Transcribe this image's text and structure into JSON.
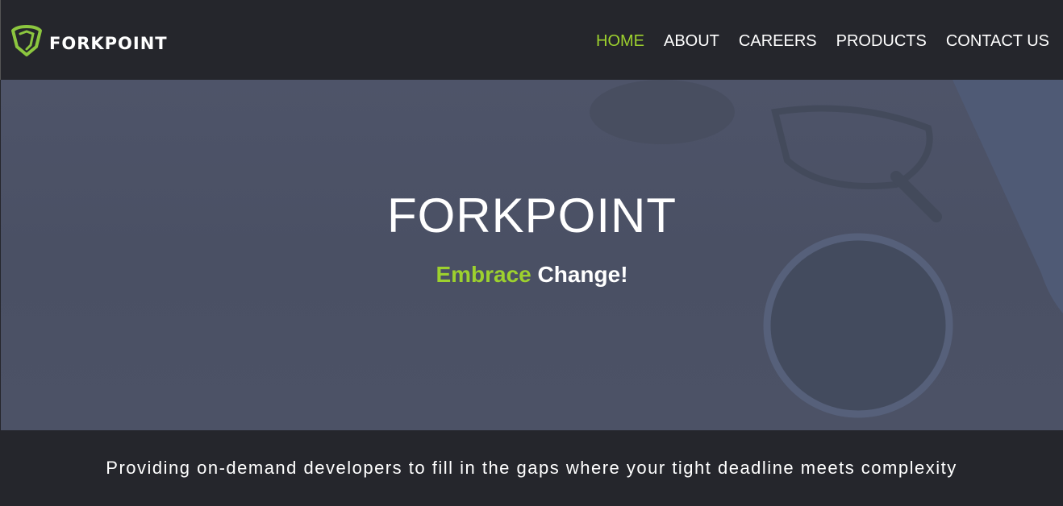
{
  "brand": {
    "name": "FORKPOINT",
    "accent": "#9dd12e",
    "logo_icon": "shield-icon"
  },
  "nav": {
    "items": [
      {
        "label": "HOME",
        "active": true
      },
      {
        "label": "ABOUT",
        "active": false
      },
      {
        "label": "CAREERS",
        "active": false
      },
      {
        "label": "PRODUCTS",
        "active": false
      },
      {
        "label": "CONTACT US",
        "active": false
      }
    ]
  },
  "hero": {
    "title": "FORKPOINT",
    "tagline_highlight": "Embrace",
    "tagline_rest": "Change!"
  },
  "footer": {
    "text": "Providing on-demand developers to fill in the gaps where your tight deadline meets complexity"
  }
}
